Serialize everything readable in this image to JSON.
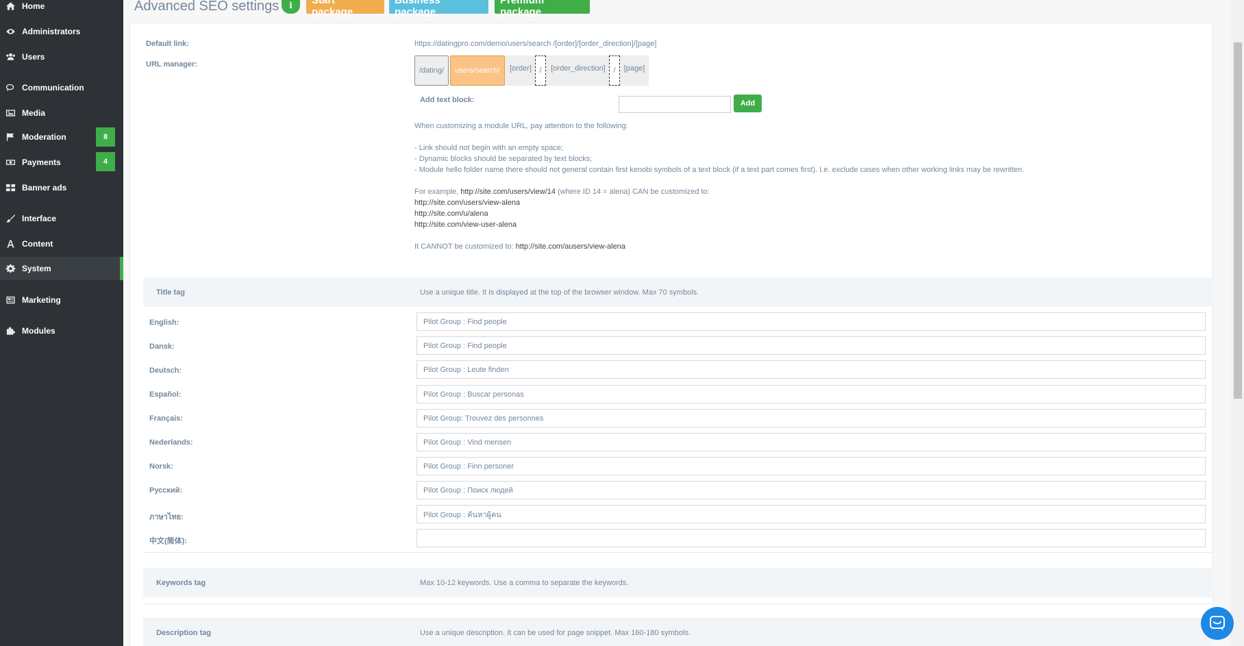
{
  "sidebar": {
    "items": [
      {
        "label": "Home",
        "icon": "home-icon"
      },
      {
        "label": "Administrators",
        "icon": "eye-icon"
      },
      {
        "label": "Users",
        "icon": "users-icon"
      },
      {
        "label": "Communication",
        "icon": "chat-icon"
      },
      {
        "label": "Media",
        "icon": "image-icon"
      },
      {
        "label": "Moderation",
        "icon": "flag-icon",
        "badge": "8"
      },
      {
        "label": "Payments",
        "icon": "money-icon",
        "badge": "4"
      },
      {
        "label": "Banner ads",
        "icon": "grid-icon"
      },
      {
        "label": "Interface",
        "icon": "brush-icon"
      },
      {
        "label": "Content",
        "icon": "font-icon"
      },
      {
        "label": "System",
        "icon": "gear-icon",
        "active": true
      },
      {
        "label": "Marketing",
        "icon": "newspaper-icon"
      },
      {
        "label": "Modules",
        "icon": "puzzle-icon"
      }
    ]
  },
  "header": {
    "title": "Advanced SEO settings",
    "info": "i",
    "packages": {
      "start": "Start package",
      "business": "Business package",
      "premium": "Premium package"
    }
  },
  "seo": {
    "default_link_label": "Default link:",
    "default_link_value": "https://datingpro.com/demo/users/search /[order]/[order_direction]/[page]",
    "url_manager_label": "URL manager:",
    "url_blocks": {
      "dating": "/dating/",
      "users_search": "users/search/",
      "order": "[order]",
      "sep1": "/",
      "order_direction": "[order_direction]",
      "sep2": "/",
      "page": "[page]"
    },
    "add_text_block_label": "Add text block:",
    "add_button": "Add",
    "notes": {
      "intro": "When customizing a module URL, pay attention to the following:",
      "rule1": "- Link should not begin with an empty space;",
      "rule2": "- Dynamic blocks should be separated by text blocks;",
      "rule3": "- Module hello folder name there should not general contain first kenobi symbols of a text block (if a text part comes first). I.e. exclude cases when other working links may be rewritten.",
      "example_prefix": "For example, ",
      "example_link": "http://site.com/users/view/14",
      "example_suffix": " (where ID 14 = alena) CAN be customized to:",
      "ok1": "http://site.com/users/view-alena",
      "ok2": "http://site.com/u/alena",
      "ok3": "http://site.com/view-user-alena",
      "bad_prefix": "It CANNOT be customized to: ",
      "bad_link": "http://site.com/ausers/view-alena"
    }
  },
  "title_tag": {
    "title": "Title tag",
    "description": "Use a unique title. It is displayed at the top of the browser window. Max 70 symbols.",
    "rows": [
      {
        "lang": "English:",
        "value": "Pilot Group : Find people"
      },
      {
        "lang": "Dansk:",
        "value": "Pilot Group : Find people"
      },
      {
        "lang": "Deutsch:",
        "value": "Pilot Group : Leute finden"
      },
      {
        "lang": "Español:",
        "value": "Pilot Group : Buscar personas"
      },
      {
        "lang": "Français:",
        "value": "Pilot Group: Trouvez des personnes"
      },
      {
        "lang": "Nederlands:",
        "value": "Pilot Group : Vind mensen"
      },
      {
        "lang": "Norsk:",
        "value": "Pilot Group : Finn personer"
      },
      {
        "lang": "Русский:",
        "value": "Pilot Group : Поиск людей"
      },
      {
        "lang": "ภาษาไทย:",
        "value": "Pilot Group : ค้นหาผู้คน"
      },
      {
        "lang": "中文(简体):",
        "value": ""
      }
    ]
  },
  "keywords_tag": {
    "title": "Keywords tag",
    "description": "Max 10-12 keywords. Use a comma to separate the keywords."
  },
  "description_tag": {
    "title": "Description tag",
    "description": "Use a unique description. It can be used for page snippet. Max 160-180 symbols."
  },
  "colors": {
    "accent": "#3fae49",
    "start": "#f0ad4e",
    "business": "#5bc0de",
    "sidebar": "#2e3236",
    "chat": "#1e88e5"
  }
}
